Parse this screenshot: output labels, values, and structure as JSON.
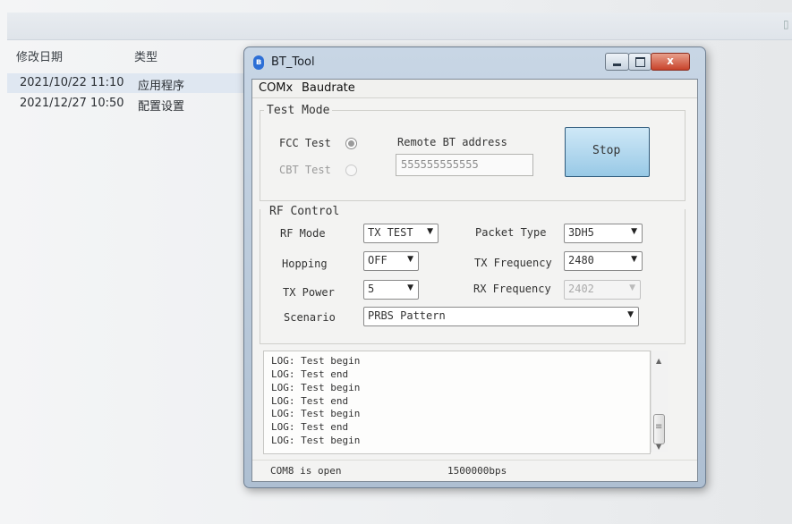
{
  "explorer": {
    "col_date": "修改日期",
    "col_type": "类型",
    "rows": [
      {
        "date": "2021/10/22 11:10",
        "type": "应用程序"
      },
      {
        "date": "2021/12/27 10:50",
        "type": "配置设置"
      }
    ]
  },
  "window": {
    "title": "BT_Tool",
    "close_glyph": "x"
  },
  "menu": [
    "COMx",
    "Baudrate"
  ],
  "test_mode": {
    "label": "Test Mode",
    "fcc_label": "FCC Test",
    "cbt_label": "CBT Test",
    "remote_label": "Remote BT address",
    "remote_value": "555555555555",
    "stop_button": "Stop"
  },
  "rf_control": {
    "label": "RF Control",
    "rf_mode_label": "RF Mode",
    "rf_mode_value": "TX TEST",
    "hopping_label": "Hopping",
    "hopping_value": "OFF",
    "tx_power_label": "TX Power",
    "tx_power_value": "5",
    "scenario_label": "Scenario",
    "scenario_value": "PRBS Pattern",
    "packet_type_label": "Packet Type",
    "packet_type_value": "3DH5",
    "tx_freq_label": "TX Frequency",
    "tx_freq_value": "2480",
    "rx_freq_label": "RX Frequency",
    "rx_freq_value": "2402"
  },
  "log": {
    "lines": [
      "LOG: Test begin",
      "LOG: Test end",
      "LOG: Test begin",
      "LOG: Test end",
      "LOG: Test begin",
      "LOG: Test end",
      "LOG: Test begin"
    ]
  },
  "status": {
    "port": "COM8 is open",
    "baud": "1500000bps"
  },
  "icons": {
    "dropdown_arrow": "▼",
    "scroll_up": "▲",
    "scroll_down": "▼"
  }
}
